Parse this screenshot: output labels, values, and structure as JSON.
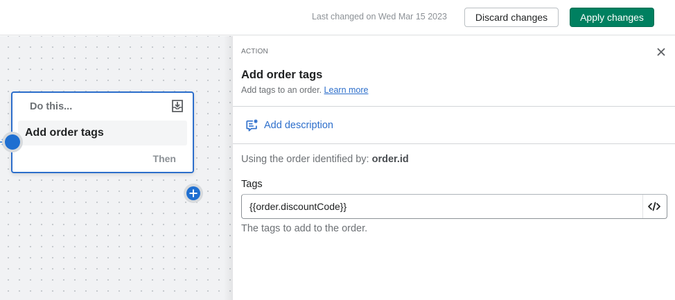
{
  "header": {
    "last_changed": "Last changed on Wed Mar 15 2023",
    "discard_label": "Discard changes",
    "apply_label": "Apply changes"
  },
  "node": {
    "header": "Do this...",
    "title": "Add order tags",
    "then_label": "Then"
  },
  "panel": {
    "kicker": "ACTION",
    "title": "Add order tags",
    "subtitle": "Add tags to an order.",
    "learn_more": "Learn more",
    "add_description": "Add description",
    "using_prefix": "Using the order identified by:",
    "using_value": "order.id",
    "tags_label": "Tags",
    "tags_value": "{{order.discountCode}}",
    "tags_help": "The tags to add to the order."
  },
  "colors": {
    "accent": "#2c6ecb",
    "node_port": "#1f6fd1",
    "primary_button": "#008060"
  },
  "icons": {
    "node_save": "download-icon",
    "close": "close-icon",
    "description": "comment-edit-icon",
    "code": "code-icon",
    "port_out": "plus-icon"
  }
}
